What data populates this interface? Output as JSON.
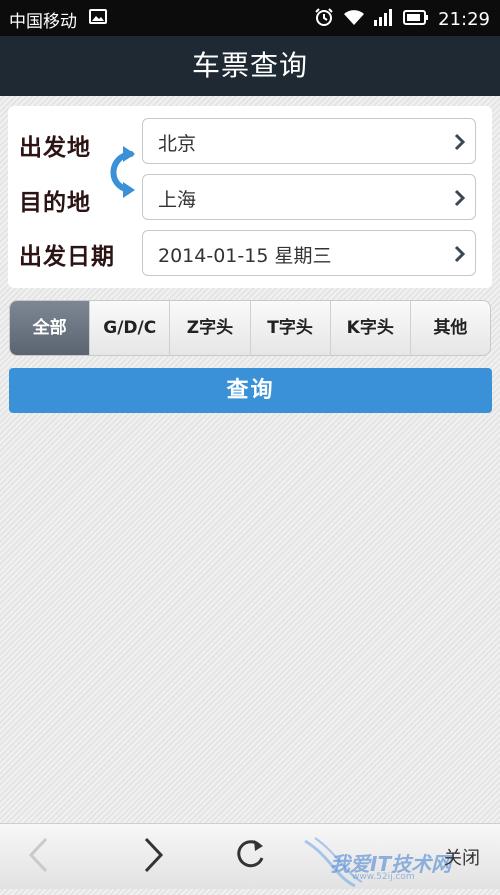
{
  "status_bar": {
    "carrier": "中国移动",
    "time": "21:29",
    "icons": [
      "image-icon",
      "alarm-icon",
      "wifi-icon",
      "signal-icon",
      "battery-icon"
    ]
  },
  "header": {
    "title": "车票查询"
  },
  "form": {
    "from_label": "出发地",
    "from_value": "北京",
    "to_label": "目的地",
    "to_value": "上海",
    "date_label": "出发日期",
    "date_value": "2014-01-15 星期三"
  },
  "train_types": [
    "全部",
    "G/D/C",
    "Z字头",
    "T字头",
    "K字头",
    "其他"
  ],
  "selected_train_type": "全部",
  "query_button": "查询",
  "bottom_bar": {
    "close_label": "关闭",
    "watermark": "我爱IT技术网",
    "watermark_url": "www.52ij.com"
  },
  "colors": {
    "header_bg": "#1f2933",
    "accent_blue": "#3a91d8",
    "active_segment": "#6b7581",
    "label_color": "#2d1414"
  }
}
